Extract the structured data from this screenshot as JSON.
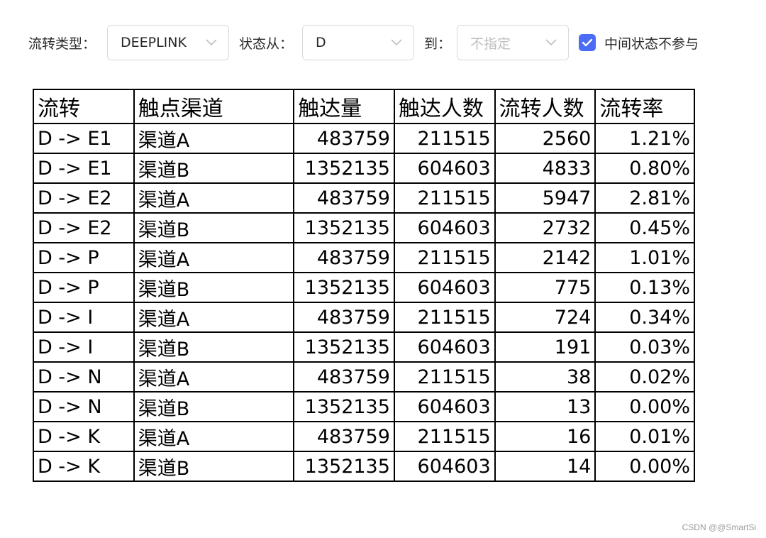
{
  "filters": {
    "type_label": "流转类型：",
    "type_value": "DEEPLINK",
    "from_label": "状态从：",
    "from_value": "D",
    "to_label": "到：",
    "to_placeholder": "不指定",
    "checkbox_checked": true,
    "checkbox_label": "中间状态不参与"
  },
  "table": {
    "headers": [
      "流转",
      "触点渠道",
      "触达量",
      "触达人数",
      "流转人数",
      "流转率"
    ],
    "rows": [
      [
        "D -> E1",
        "渠道A",
        "483759",
        "211515",
        "2560",
        "1.21%"
      ],
      [
        "D -> E1",
        "渠道B",
        "1352135",
        "604603",
        "4833",
        "0.80%"
      ],
      [
        "D -> E2",
        "渠道A",
        "483759",
        "211515",
        "5947",
        "2.81%"
      ],
      [
        "D -> E2",
        "渠道B",
        "1352135",
        "604603",
        "2732",
        "0.45%"
      ],
      [
        "D -> P",
        "渠道A",
        "483759",
        "211515",
        "2142",
        "1.01%"
      ],
      [
        "D -> P",
        "渠道B",
        "1352135",
        "604603",
        "775",
        "0.13%"
      ],
      [
        "D -> I",
        "渠道A",
        "483759",
        "211515",
        "724",
        "0.34%"
      ],
      [
        "D -> I",
        "渠道B",
        "1352135",
        "604603",
        "191",
        "0.03%"
      ],
      [
        "D -> N",
        "渠道A",
        "483759",
        "211515",
        "38",
        "0.02%"
      ],
      [
        "D -> N",
        "渠道B",
        "1352135",
        "604603",
        "13",
        "0.00%"
      ],
      [
        "D -> K",
        "渠道A",
        "483759",
        "211515",
        "16",
        "0.01%"
      ],
      [
        "D -> K",
        "渠道B",
        "1352135",
        "604603",
        "14",
        "0.00%"
      ]
    ]
  },
  "watermark": "CSDN @@SmartSi",
  "colors": {
    "accent": "#4a6cf7",
    "border": "#d9d9d9",
    "placeholder": "#bfbfbf"
  },
  "icons": {
    "dropdown": "chevron-down-icon",
    "checkbox": "check-icon"
  }
}
